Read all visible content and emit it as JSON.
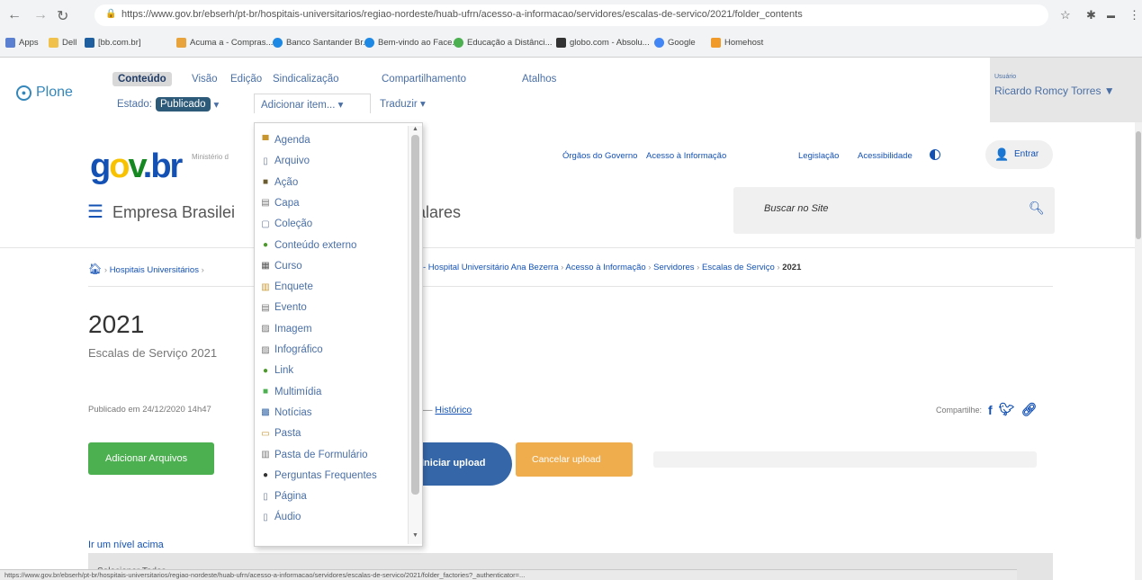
{
  "browser": {
    "url": "https://www.gov.br/ebserh/pt-br/hospitais-universitarios/regiao-nordeste/huab-ufrn/acesso-a-informacao/servidores/escalas-de-servico/2021/folder_contents",
    "bookmarks": [
      "Apps",
      "Dell",
      "[bb.com.br]",
      "Acuma a - Compras...",
      "Banco Santander Br...",
      "Bem-vindo ao Face...",
      "Educação a Distânci...",
      "globo.com - Absolu...",
      "Google",
      "Homehost"
    ]
  },
  "plone": {
    "logo": "Plone",
    "tabs": [
      "Conteúdo",
      "Visão",
      "Edição",
      "Sindicalização",
      "Compartilhamento",
      "Atalhos"
    ],
    "estado_label": "Estado:",
    "estado_value": "Publicado",
    "add_item": "Adicionar item... ▾",
    "translate": "Traduzir ▾",
    "user_label": "Usuário",
    "user_name": "Ricardo Romcy Torres ▼"
  },
  "site": {
    "logo": {
      "g": "g",
      "o": "o",
      "v": "v",
      "br": ".br"
    },
    "ministry": "Ministério d",
    "top_links": [
      "Órgãos do Governo",
      "Acesso à Informação",
      "Legislação",
      "Acessibilidade"
    ],
    "login": "Entrar",
    "org_name_left": "Empresa Brasilei",
    "org_name_right": "alares",
    "search_placeholder": "Buscar no Site"
  },
  "breadcrumbs": {
    "left": "Hospitais Universitários",
    "right": [
      "- Hospital Universitário Ana Bezerra",
      "Acesso à Informação",
      "Servidores",
      "Escalas de Serviço"
    ],
    "current": "2021"
  },
  "page": {
    "title": "2021",
    "description": "Escalas de Serviço 2021",
    "published": "Publicado em 24/12/2020 14h47",
    "history_prefix": "— ",
    "history_link": "Histórico",
    "share_label": "Compartilhe:",
    "btn_add": "Adicionar Arquivos",
    "btn_upload": "Iniciar upload",
    "btn_cancel": "Cancelar upload",
    "up_level": "Ir um nível acima",
    "select_all": "Selecionar Todos"
  },
  "status_url": "https://www.gov.br/ebserh/pt-br/hospitais-universitarios/regiao-nordeste/huab-ufrn/acesso-a-informacao/servidores/escalas-de-servico/2021/folder_factories?_authenticator=...",
  "menu": {
    "items": [
      {
        "label": "Agenda",
        "icon": "calendar-icon",
        "color": "#c8962e"
      },
      {
        "label": "Arquivo",
        "icon": "file-icon",
        "color": "#6b7a99"
      },
      {
        "label": "Ação",
        "icon": "action-icon",
        "color": "#6b5b2e"
      },
      {
        "label": "Capa",
        "icon": "cover-icon",
        "color": "#777777"
      },
      {
        "label": "Coleção",
        "icon": "collection-icon",
        "color": "#6b7a99"
      },
      {
        "label": "Conteúdo externo",
        "icon": "external-content-icon",
        "color": "#4c9a2a"
      },
      {
        "label": "Curso",
        "icon": "course-icon",
        "color": "#555555"
      },
      {
        "label": "Enquete",
        "icon": "poll-icon",
        "color": "#c8962e"
      },
      {
        "label": "Evento",
        "icon": "event-icon",
        "color": "#777777"
      },
      {
        "label": "Imagem",
        "icon": "image-icon",
        "color": "#777777"
      },
      {
        "label": "Infográfico",
        "icon": "infographic-icon",
        "color": "#777777"
      },
      {
        "label": "Link",
        "icon": "link-icon",
        "color": "#4c9a2a"
      },
      {
        "label": "Multimídia",
        "icon": "multimedia-icon",
        "color": "#4caf50"
      },
      {
        "label": "Notícias",
        "icon": "news-icon",
        "color": "#3567a8"
      },
      {
        "label": "Pasta",
        "icon": "folder-icon",
        "color": "#c8962e"
      },
      {
        "label": "Pasta de Formulário",
        "icon": "form-folder-icon",
        "color": "#777777"
      },
      {
        "label": "Perguntas Frequentes",
        "icon": "faq-icon",
        "color": "#333333"
      },
      {
        "label": "Página",
        "icon": "page-icon",
        "color": "#6b7a99"
      },
      {
        "label": "Áudio",
        "icon": "audio-icon",
        "color": "#6b7a99"
      }
    ]
  }
}
